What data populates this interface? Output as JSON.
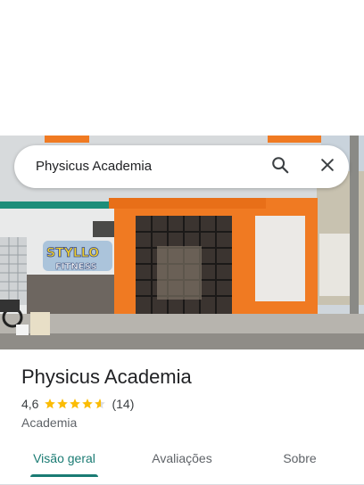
{
  "search": {
    "query": "Physicus Academia"
  },
  "icons": {
    "search": "search-icon",
    "close": "close-icon",
    "star": "star-icon"
  },
  "place": {
    "title": "Physicus Academia",
    "rating": "4,6",
    "rating_value": 4.6,
    "review_count": "(14)",
    "category": "Academia",
    "photo_sign_text_1": "STYLLO",
    "photo_sign_text_2": "FITNESS"
  },
  "tabs": [
    {
      "label": "Visão geral",
      "active": true
    },
    {
      "label": "Avaliações",
      "active": false
    },
    {
      "label": "Sobre",
      "active": false
    }
  ],
  "colors": {
    "accent": "#1a7b73",
    "star": "#fbbc04",
    "building_orange": "#f07a22"
  }
}
